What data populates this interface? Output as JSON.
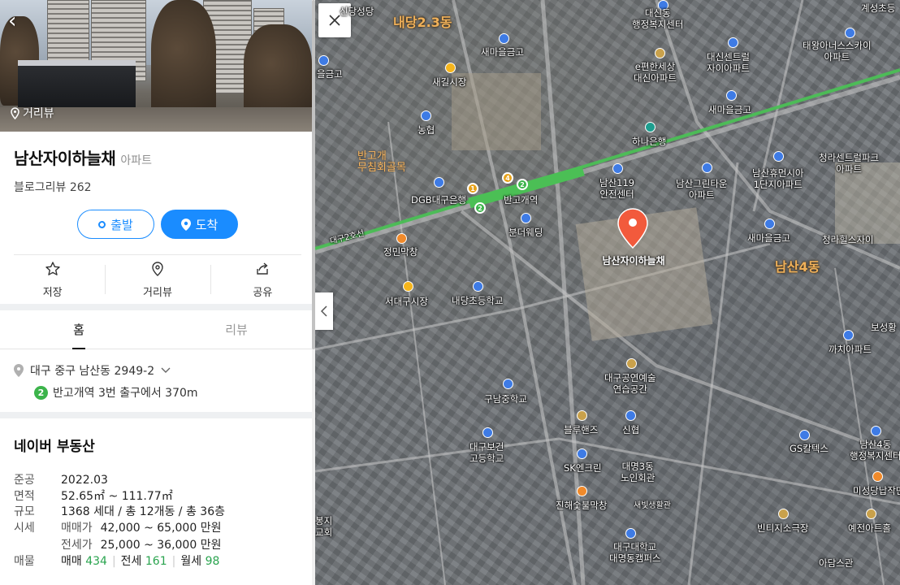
{
  "panel": {
    "photo_label": "거리뷰",
    "name": "남산자이하늘채",
    "category": "아파트",
    "blog_review": "블로그리뷰 262",
    "start_button": "출발",
    "dest_button": "도착",
    "actions": [
      {
        "label": "저장",
        "icon": "star-icon"
      },
      {
        "label": "거리뷰",
        "icon": "pin-outline-icon"
      },
      {
        "label": "공유",
        "icon": "share-icon"
      }
    ],
    "tabs": [
      {
        "label": "홈"
      },
      {
        "label": "리뷰"
      }
    ],
    "address": "대구 중구 남산동 2949-2",
    "subway_line": "2",
    "subway_info": "반고개역 3번 출구에서 370m",
    "realestate": {
      "title": "네이버 부동산",
      "built_label": "준공",
      "built": "2022.03",
      "area_label": "면적",
      "area": "52.65㎡ ~ 111.77㎡",
      "scale_label": "규모",
      "scale": "1368 세대 / 총 12개동 / 총 36층",
      "price_label": "시세",
      "sale_label": "매매가",
      "sale": "42,000 ~ 65,000 만원",
      "jeonse_label": "전세가",
      "jeonse": "25,000 ~ 36,000 만원",
      "listing_label": "매물",
      "l_sale_label": "매매",
      "l_sale": "434",
      "l_jeonse_label": "전세",
      "l_jeonse": "161",
      "l_monthly_label": "월세",
      "l_monthly": "98"
    }
  },
  "map": {
    "marker_label": "남산자이하늘채",
    "districts": [
      "내당2.3동",
      "남산4동"
    ],
    "market_label": "반고개\n무침회골목",
    "line_label": "대구2호선",
    "stations": [
      "1",
      "4",
      "2",
      "2"
    ],
    "labels": [
      "계성초등",
      "신당성당",
      "대신동\n행정복지센터",
      "새마을금고",
      "태왕아너스스카이\n아파트",
      "대신센트럴\n자이아파트",
      "e편한세상\n대신아파트",
      "을금고",
      "새길시장",
      "새마을금고",
      "농협",
      "하나은행",
      "청라센트럴파크\n아파트",
      "DGB대구은행",
      "반고개역",
      "남산119\n안전센터",
      "남산그린타운\n아파트",
      "남산휴먼시아\n1단지아파트",
      "분더웨딩",
      "새마을금고",
      "청라힐스자이",
      "정민막창",
      "서대구시장",
      "내당초등학교",
      "보성황",
      "까치아파트",
      "대구공연예술\n연습공간",
      "구남중학교",
      "블루핸즈",
      "신협",
      "대구보건\n고등학교",
      "GS칼텍스",
      "남산4동\n행정복지센터",
      "SK엔크린",
      "대명3동\n노인회관",
      "미성당납작만",
      "진해숯불막창",
      "새빛생활관",
      "봉지\n교회",
      "빈티지소극장",
      "예전아트홀",
      "대구대학교\n대명동캠퍼스",
      "아담스관"
    ]
  }
}
